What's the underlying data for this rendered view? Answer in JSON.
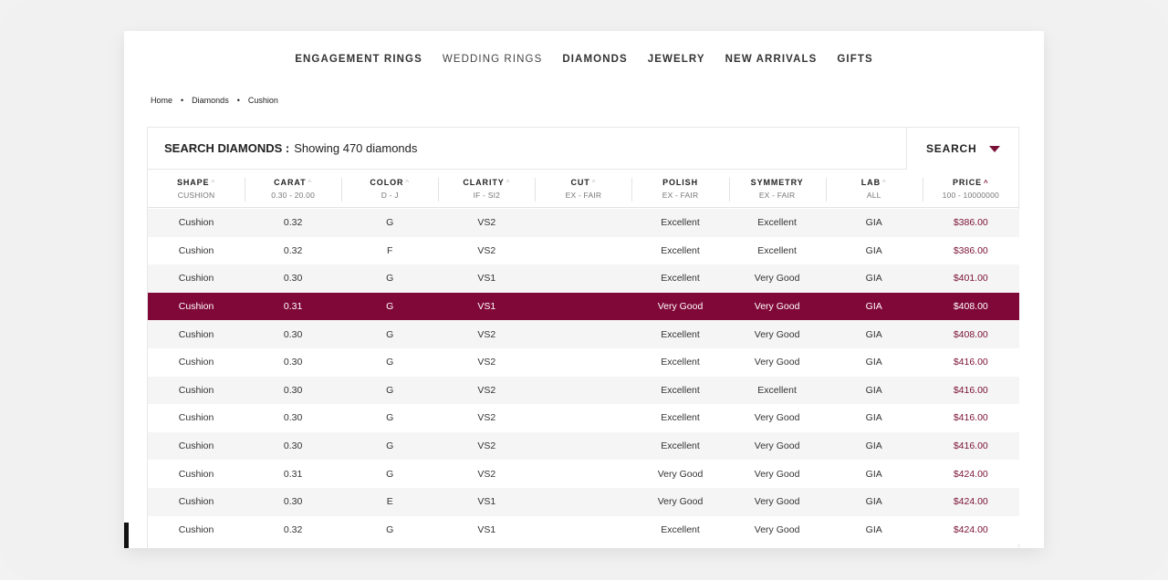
{
  "nav": {
    "items": [
      {
        "label": "ENGAGEMENT RINGS",
        "style": "bold"
      },
      {
        "label": "WEDDING RINGS",
        "style": "light"
      },
      {
        "label": "DIAMONDS",
        "style": "bold"
      },
      {
        "label": "JEWELRY",
        "style": "bold"
      },
      {
        "label": "NEW ARRIVALS",
        "style": "bold"
      },
      {
        "label": "GIFTS",
        "style": "bold"
      }
    ]
  },
  "breadcrumb": [
    "Home",
    "Diamonds",
    "Cushion"
  ],
  "search": {
    "title": "SEARCH DIAMONDS :",
    "count_text": "Showing 470 diamonds",
    "button_label": "SEARCH"
  },
  "columns": [
    {
      "label": "SHAPE",
      "sub": "CUSHION",
      "sort": "up"
    },
    {
      "label": "CARAT",
      "sub": "0.30 - 20.00",
      "sort": "up"
    },
    {
      "label": "COLOR",
      "sub": "D - J",
      "sort": "up"
    },
    {
      "label": "CLARITY",
      "sub": "IF - SI2",
      "sort": "up"
    },
    {
      "label": "CUT",
      "sub": "EX - FAIR",
      "sort": "up"
    },
    {
      "label": "POLISH",
      "sub": "EX - FAIR",
      "sort": ""
    },
    {
      "label": "SYMMETRY",
      "sub": "EX - FAIR",
      "sort": ""
    },
    {
      "label": "LAB",
      "sub": "ALL",
      "sort": "up"
    },
    {
      "label": "PRICE",
      "sub": "100 - 10000000",
      "sort": "active"
    }
  ],
  "rows": [
    {
      "shape": "Cushion",
      "carat": "0.32",
      "color": "G",
      "clarity": "VS2",
      "cut": "",
      "polish": "Excellent",
      "symmetry": "Excellent",
      "lab": "GIA",
      "price": "$386.00",
      "selected": false
    },
    {
      "shape": "Cushion",
      "carat": "0.32",
      "color": "F",
      "clarity": "VS2",
      "cut": "",
      "polish": "Excellent",
      "symmetry": "Excellent",
      "lab": "GIA",
      "price": "$386.00",
      "selected": false
    },
    {
      "shape": "Cushion",
      "carat": "0.30",
      "color": "G",
      "clarity": "VS1",
      "cut": "",
      "polish": "Excellent",
      "symmetry": "Very Good",
      "lab": "GIA",
      "price": "$401.00",
      "selected": false
    },
    {
      "shape": "Cushion",
      "carat": "0.31",
      "color": "G",
      "clarity": "VS1",
      "cut": "",
      "polish": "Very Good",
      "symmetry": "Very Good",
      "lab": "GIA",
      "price": "$408.00",
      "selected": true
    },
    {
      "shape": "Cushion",
      "carat": "0.30",
      "color": "G",
      "clarity": "VS2",
      "cut": "",
      "polish": "Excellent",
      "symmetry": "Very Good",
      "lab": "GIA",
      "price": "$408.00",
      "selected": false
    },
    {
      "shape": "Cushion",
      "carat": "0.30",
      "color": "G",
      "clarity": "VS2",
      "cut": "",
      "polish": "Excellent",
      "symmetry": "Very Good",
      "lab": "GIA",
      "price": "$416.00",
      "selected": false
    },
    {
      "shape": "Cushion",
      "carat": "0.30",
      "color": "G",
      "clarity": "VS2",
      "cut": "",
      "polish": "Excellent",
      "symmetry": "Excellent",
      "lab": "GIA",
      "price": "$416.00",
      "selected": false
    },
    {
      "shape": "Cushion",
      "carat": "0.30",
      "color": "G",
      "clarity": "VS2",
      "cut": "",
      "polish": "Excellent",
      "symmetry": "Very Good",
      "lab": "GIA",
      "price": "$416.00",
      "selected": false
    },
    {
      "shape": "Cushion",
      "carat": "0.30",
      "color": "G",
      "clarity": "VS2",
      "cut": "",
      "polish": "Excellent",
      "symmetry": "Very Good",
      "lab": "GIA",
      "price": "$416.00",
      "selected": false
    },
    {
      "shape": "Cushion",
      "carat": "0.31",
      "color": "G",
      "clarity": "VS2",
      "cut": "",
      "polish": "Very Good",
      "symmetry": "Very Good",
      "lab": "GIA",
      "price": "$424.00",
      "selected": false
    },
    {
      "shape": "Cushion",
      "carat": "0.30",
      "color": "E",
      "clarity": "VS1",
      "cut": "",
      "polish": "Very Good",
      "symmetry": "Very Good",
      "lab": "GIA",
      "price": "$424.00",
      "selected": false
    },
    {
      "shape": "Cushion",
      "carat": "0.32",
      "color": "G",
      "clarity": "VS1",
      "cut": "",
      "polish": "Excellent",
      "symmetry": "Very Good",
      "lab": "GIA",
      "price": "$424.00",
      "selected": false
    }
  ],
  "colors": {
    "accent": "#800838",
    "price_text": "#7a1035"
  }
}
